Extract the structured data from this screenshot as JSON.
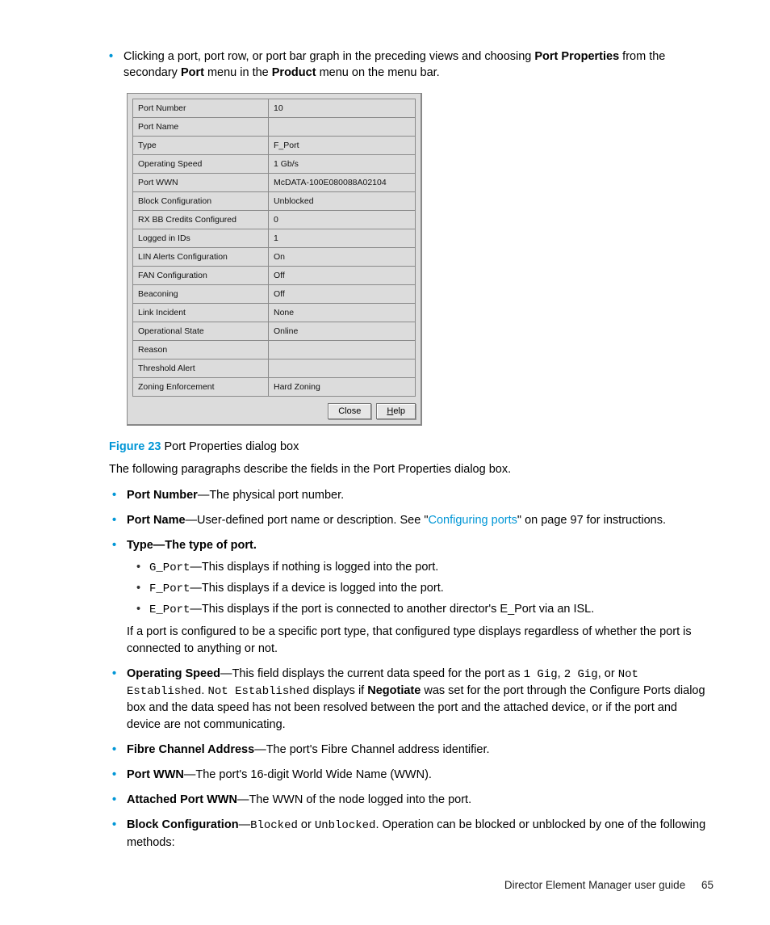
{
  "intro": {
    "prefix": "Clicking a port, port row, or port bar graph in the preceding views and choosing ",
    "bold1": "Port Properties",
    "mid1": " from the secondary ",
    "bold2": "Port",
    "mid2": " menu in the ",
    "bold3": "Product",
    "suffix": " menu on the menu bar."
  },
  "dialog": {
    "rows": [
      {
        "label": "Port Number",
        "value": "10"
      },
      {
        "label": "Port Name",
        "value": ""
      },
      {
        "label": "Type",
        "value": "F_Port"
      },
      {
        "label": "Operating Speed",
        "value": "1 Gb/s"
      },
      {
        "label": "Port WWN",
        "value": "McDATA-100E080088A02104"
      },
      {
        "label": "Block Configuration",
        "value": "Unblocked"
      },
      {
        "label": "RX BB Credits Configured",
        "value": "0"
      },
      {
        "label": "Logged in IDs",
        "value": "1"
      },
      {
        "label": "LIN Alerts Configuration",
        "value": "On"
      },
      {
        "label": "FAN Configuration",
        "value": "Off"
      },
      {
        "label": "Beaconing",
        "value": "Off"
      },
      {
        "label": "Link Incident",
        "value": "None"
      },
      {
        "label": "Operational State",
        "value": "Online"
      },
      {
        "label": "Reason",
        "value": ""
      },
      {
        "label": "Threshold Alert",
        "value": ""
      },
      {
        "label": "Zoning Enforcement",
        "value": "Hard Zoning"
      }
    ],
    "buttons": {
      "close": "Close",
      "help": "elp",
      "help_prefix": "H"
    }
  },
  "figure": {
    "label": "Figure 23",
    "caption": " Port Properties dialog box"
  },
  "following": "The following paragraphs describe the fields in the Port Properties dialog box.",
  "items": {
    "portnum": {
      "head": "Port Number",
      "dash": "—",
      "text": "The physical port number."
    },
    "portname": {
      "head": "Port Name",
      "dash": "—",
      "t1": "User-defined port name or description. See \"",
      "link": "Configuring ports",
      "t2": "\" on page 97 for instructions."
    },
    "type": {
      "head": "Type",
      "dash": "—",
      "boldrest": "The type of port.",
      "sub": [
        {
          "code": "G_Port",
          "dash": "—",
          "text": "This displays if nothing is logged into the port."
        },
        {
          "code": "F_Port",
          "dash": "—",
          "text": "This displays if a device is logged into the port."
        },
        {
          "code": "E_Port",
          "dash": "—",
          "text": "This displays if the port is connected to another director's E_Port via an ISL."
        }
      ],
      "after": "If a port is configured to be a specific port type, that configured type displays regardless of whether the port is connected to anything or not."
    },
    "opspeed": {
      "head": "Operating Speed",
      "dash": "—",
      "t1": "This field displays the current data speed for the port as ",
      "c1": "1 Gig",
      "comma": ", ",
      "c2": "2 Gig",
      "or": ", or ",
      "c3": "Not Established",
      "period": ". ",
      "c4": "Not Established",
      "t2": " displays if ",
      "neg": "Negotiate",
      "t3": " was set for the port through the Configure Ports dialog box and the data speed has not been resolved between the port and the attached device, or if the port and device are not communicating."
    },
    "fca": {
      "head": "Fibre Channel Address",
      "dash": "—",
      "text": "The port's Fibre Channel address identifier."
    },
    "pwwn": {
      "head": "Port WWN",
      "dash": "—",
      "text": "The port's 16-digit World Wide Name (WWN)."
    },
    "apwwn": {
      "head": "Attached Port WWN",
      "dash": "—",
      "text": "The WWN of the node logged into the port."
    },
    "block": {
      "head": "Block Configuration",
      "dash": "—",
      "c1": "Blocked",
      "or": " or ",
      "c2": "Unblocked",
      "text": ". Operation can be blocked or unblocked by one of the following methods:"
    }
  },
  "footer": {
    "title": "Director Element Manager user guide",
    "page": "65"
  }
}
